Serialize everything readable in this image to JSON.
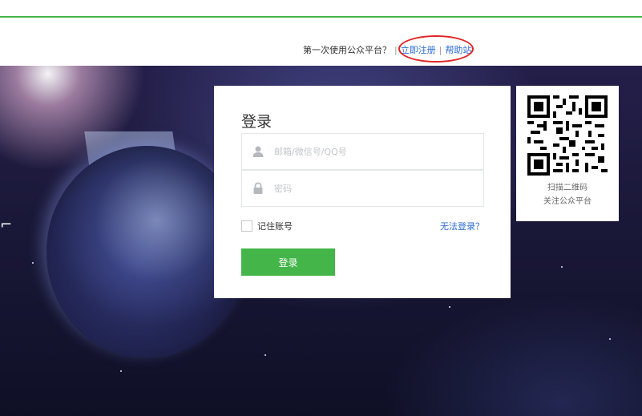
{
  "header": {
    "first_time_text": "第一次使用公众平台？",
    "separator": "|",
    "register_link": "立即注册",
    "help_link": "帮助站"
  },
  "login": {
    "title": "登录",
    "username_placeholder": "邮箱/微信号/QQ号",
    "password_placeholder": "密码",
    "remember_label": "记住账号",
    "forgot_link": "无法登录？",
    "submit_label": "登录"
  },
  "qr": {
    "line1": "扫描二维码",
    "line2": "关注公众平台"
  },
  "colors": {
    "accent_green": "#44b549",
    "link_blue": "#2a6bd6",
    "annotation_red": "#e02424"
  }
}
